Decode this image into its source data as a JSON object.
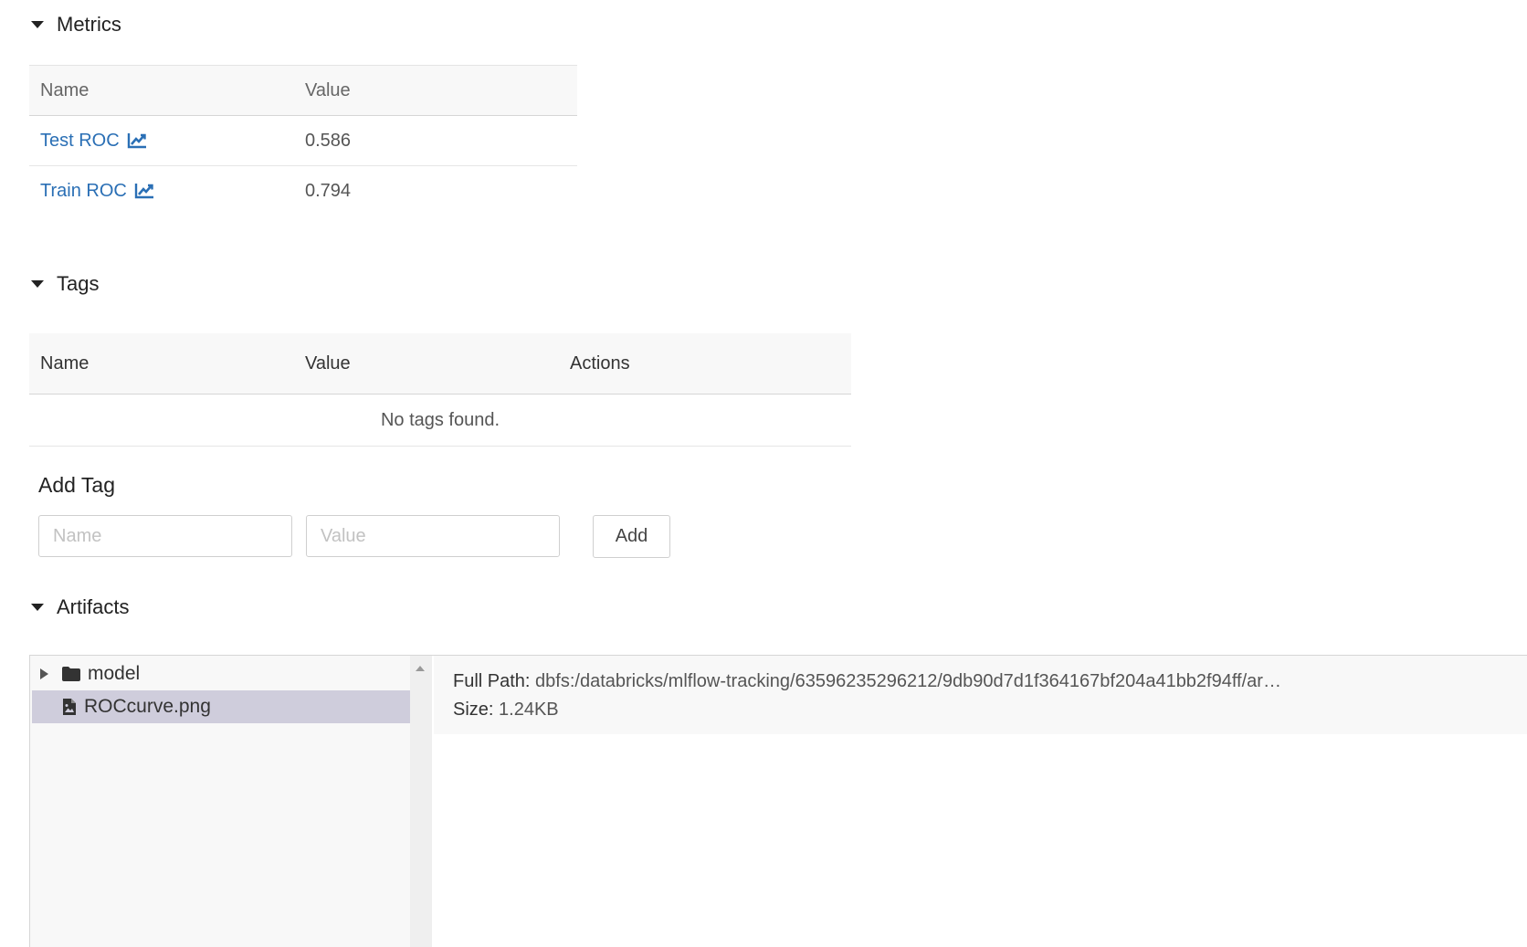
{
  "metrics": {
    "title": "Metrics",
    "columns": {
      "name": "Name",
      "value": "Value"
    },
    "rows": [
      {
        "name": "Test ROC",
        "value": "0.586"
      },
      {
        "name": "Train ROC",
        "value": "0.794"
      }
    ]
  },
  "tags": {
    "title": "Tags",
    "columns": {
      "name": "Name",
      "value": "Value",
      "actions": "Actions"
    },
    "empty_text": "No tags found.",
    "add_title": "Add Tag",
    "name_placeholder": "Name",
    "value_placeholder": "Value",
    "add_label": "Add"
  },
  "artifacts": {
    "title": "Artifacts",
    "tree": [
      {
        "label": "model",
        "type": "folder",
        "expanded": false
      },
      {
        "label": "ROCcurve.png",
        "type": "image-file",
        "selected": true
      }
    ],
    "details": {
      "full_path_label": "Full Path:",
      "full_path_value": "dbfs:/databricks/mlflow-tracking/63596235296212/9db90d7d1f364167bf204a41bb2f94ff/ar…",
      "size_label": "Size:",
      "size_value": "1.24KB"
    }
  },
  "colors": {
    "link": "#2a6fb5",
    "selected_row": "#cfcddc"
  }
}
